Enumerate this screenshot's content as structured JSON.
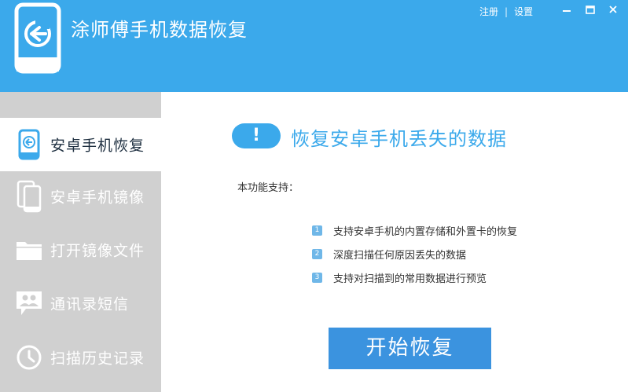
{
  "header": {
    "title": "涂师傅手机数据恢复",
    "register": "注册",
    "separator": "|",
    "settings": "设置"
  },
  "sidebar": {
    "items": [
      {
        "label": "安卓手机恢复",
        "icon": "phone-restore-icon",
        "active": true
      },
      {
        "label": "安卓手机镜像",
        "icon": "phone-mirror-icon",
        "active": false
      },
      {
        "label": "打开镜像文件",
        "icon": "folder-icon",
        "active": false
      },
      {
        "label": "通讯录短信",
        "icon": "contacts-chat-icon",
        "active": false
      },
      {
        "label": "扫描历史记录",
        "icon": "clock-icon",
        "active": false
      }
    ]
  },
  "main": {
    "alert_glyph": "!",
    "title": "恢复安卓手机丢失的数据",
    "support_label": "本功能支持：",
    "features": [
      {
        "num": "1",
        "text": "支持安卓手机的内置存储和外置卡的恢复"
      },
      {
        "num": "2",
        "text": "深度扫描任何原因丢失的数据"
      },
      {
        "num": "3",
        "text": "支持对扫描到的常用数据进行预览"
      }
    ],
    "start_button": "开始恢复"
  },
  "colors": {
    "accent": "#3ba9eb",
    "button": "#3b93df",
    "sidebar_bg": "#d0d0d0",
    "active_text": "#1e2f40"
  }
}
